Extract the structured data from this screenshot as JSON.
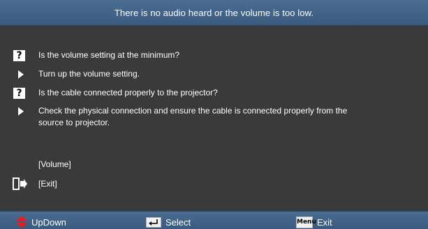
{
  "title": "There is no audio heard or the volume is too low.",
  "items": [
    {
      "kind": "question",
      "text": "Is the volume setting at the minimum?"
    },
    {
      "kind": "answer",
      "text": "Turn up the volume setting."
    },
    {
      "kind": "question",
      "text": "Is the cable connected properly to the projector?"
    },
    {
      "kind": "answer",
      "text": "Check the physical connection and ensure the cable is connected properly from the",
      "text2": "source to projector."
    }
  ],
  "links": {
    "volume": "[Volume]",
    "exit": "[Exit]"
  },
  "footer": {
    "updown": "UpDown",
    "select": "Select",
    "exit": "Exit",
    "menu_key": "Menu"
  },
  "icons": {
    "question": "question-mark-icon",
    "answer": "triangle-arrow-icon",
    "exit": "exit-door-icon",
    "updown": "up-down-arrow-icon",
    "select": "enter-key-icon",
    "menu": "menu-key-icon"
  },
  "colors": {
    "title_bar": "#4b6d92",
    "background": "#3a3a3a",
    "updown_arrow": "#e02020"
  }
}
